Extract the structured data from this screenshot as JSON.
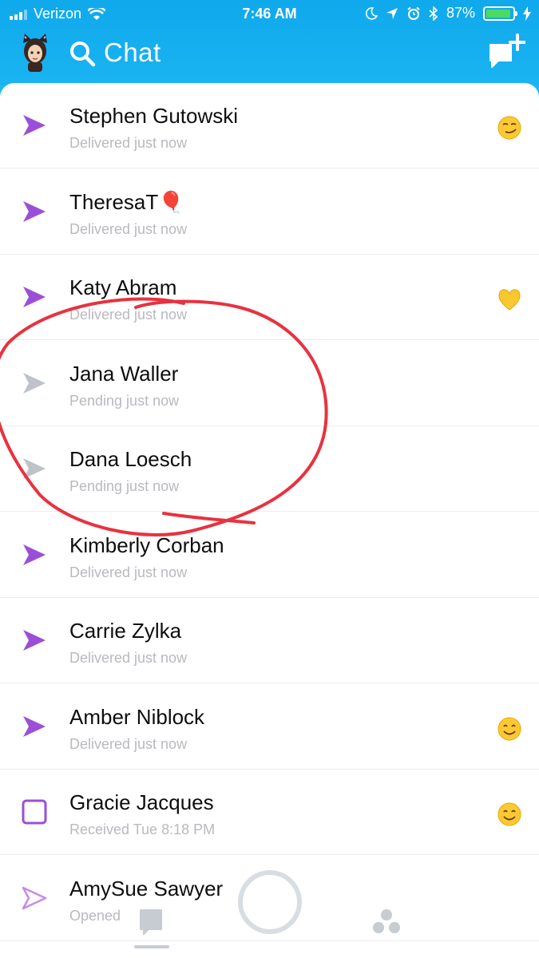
{
  "status_bar": {
    "carrier": "Verizon",
    "time": "7:46 AM",
    "battery": "87%"
  },
  "header": {
    "title": "Chat"
  },
  "chats": [
    {
      "name": "Stephen Gutowski",
      "status": "Delivered just now",
      "type": "delivered",
      "emoji": "smirk"
    },
    {
      "name": "TheresaT🎈",
      "status": "Delivered just now",
      "type": "delivered",
      "emoji": ""
    },
    {
      "name": "Katy Abram",
      "status": "Delivered just now",
      "type": "delivered",
      "emoji": "yellow-heart"
    },
    {
      "name": "Jana Waller",
      "status": "Pending just now",
      "type": "pending",
      "emoji": ""
    },
    {
      "name": "Dana Loesch",
      "status": "Pending just now",
      "type": "pending",
      "emoji": ""
    },
    {
      "name": "Kimberly Corban",
      "status": "Delivered just now",
      "type": "delivered",
      "emoji": ""
    },
    {
      "name": "Carrie Zylka",
      "status": "Delivered just now",
      "type": "delivered",
      "emoji": ""
    },
    {
      "name": "Amber Niblock",
      "status": "Delivered just now",
      "type": "delivered",
      "emoji": "smile"
    },
    {
      "name": "Gracie Jacques",
      "status": "Received Tue 8:18 PM",
      "type": "received",
      "emoji": "smile"
    },
    {
      "name": "AmySue Sawyer",
      "status": "Opened",
      "type": "opened",
      "emoji": ""
    }
  ],
  "colors": {
    "header_blue": "#1ab4f2",
    "delivered_purple": "#9b4fd8",
    "pending_gray": "#bfc3c9",
    "annotation_red": "#e8323f"
  }
}
